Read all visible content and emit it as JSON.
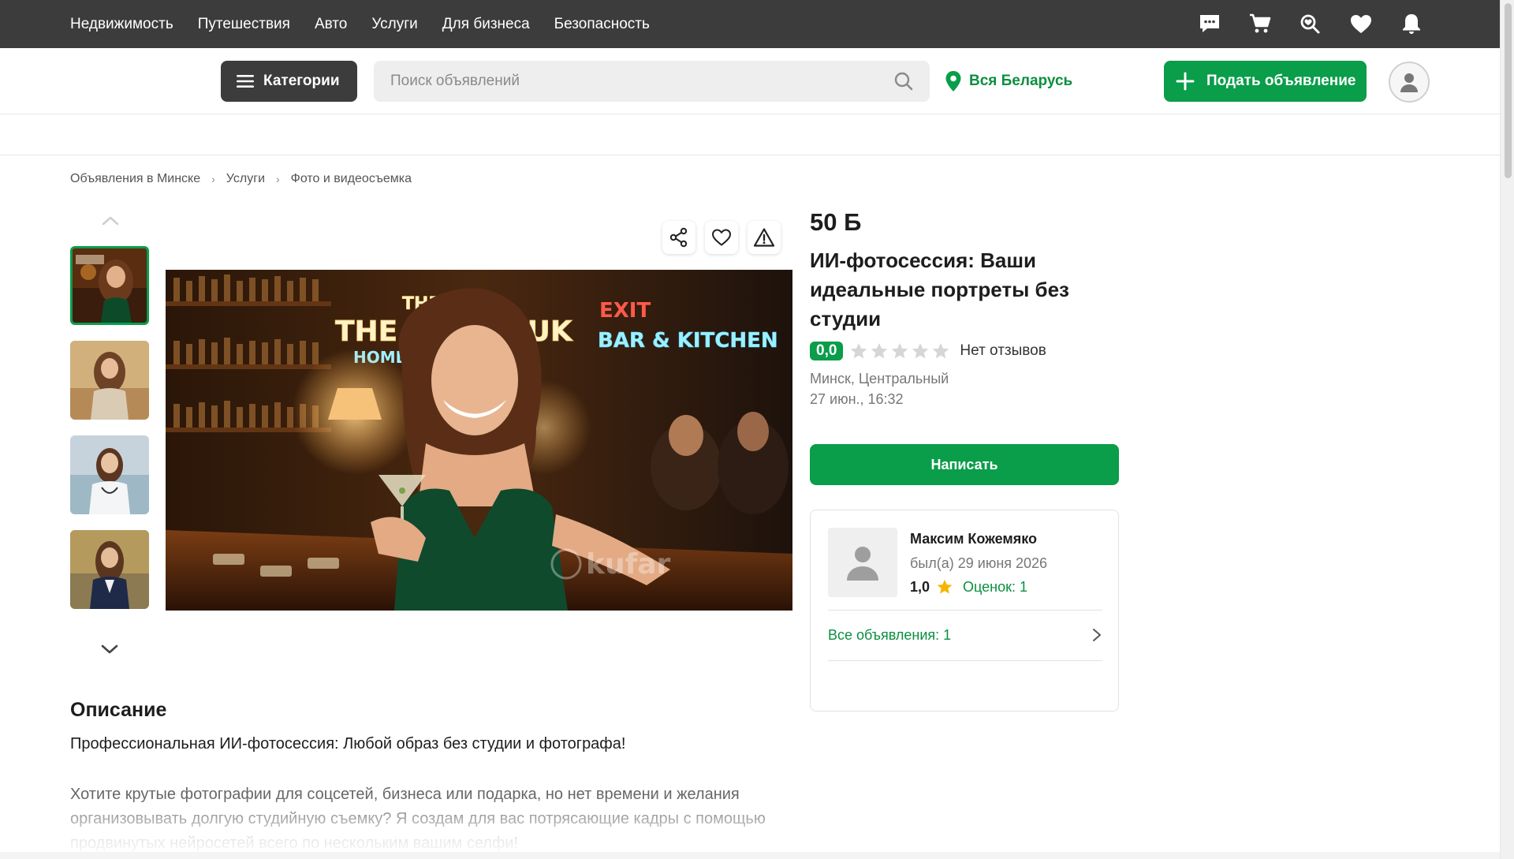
{
  "topnav": {
    "links": [
      "Недвижимость",
      "Путешествия",
      "Авто",
      "Услуги",
      "Для бизнеса",
      "Безопасность"
    ],
    "icons": [
      "chat-icon",
      "cart-icon",
      "saved-search-icon",
      "heart-icon",
      "bell-icon"
    ]
  },
  "header": {
    "categories_label": "Категории",
    "search_placeholder": "Поиск объявлений",
    "region_label": "Вся Беларусь",
    "post_label": "Подать объявление"
  },
  "breadcrumb": [
    "Объявления в Минске",
    "Услуги",
    "Фото и видеосъемка"
  ],
  "listing": {
    "price": "50 Б",
    "title": "ИИ-фотосессия: Ваши идеальные портреты без студии",
    "rating": "0,0",
    "reviews": "Нет отзывов",
    "location": "Минск, Центральный",
    "date": "27 июн., 16:32",
    "write_label": "Написать",
    "image_watermark": "kufar"
  },
  "seller": {
    "name": "Максим Кожемяко",
    "last_seen": "был(а) 29 июня 2026",
    "rating": "1,0",
    "ratings_count": "Оценок: 1",
    "all_ads": "Все объявления: 1"
  },
  "description": {
    "heading": "Описание",
    "lead": "Профессиональная ИИ-фотосессия: Любой образ без студии и фотографа!",
    "body": "Хотите крутые фотографии для соцсетей, бизнеса или подарка, но нет времени и желания организовывать долгую студийную съемку? Я создам для вас потрясающие кадры с помощью продвинутых нейросетей всего по нескольким вашим селфи!"
  },
  "colors": {
    "accent": "#0a9d4a",
    "topbar": "#3c3c3c"
  }
}
